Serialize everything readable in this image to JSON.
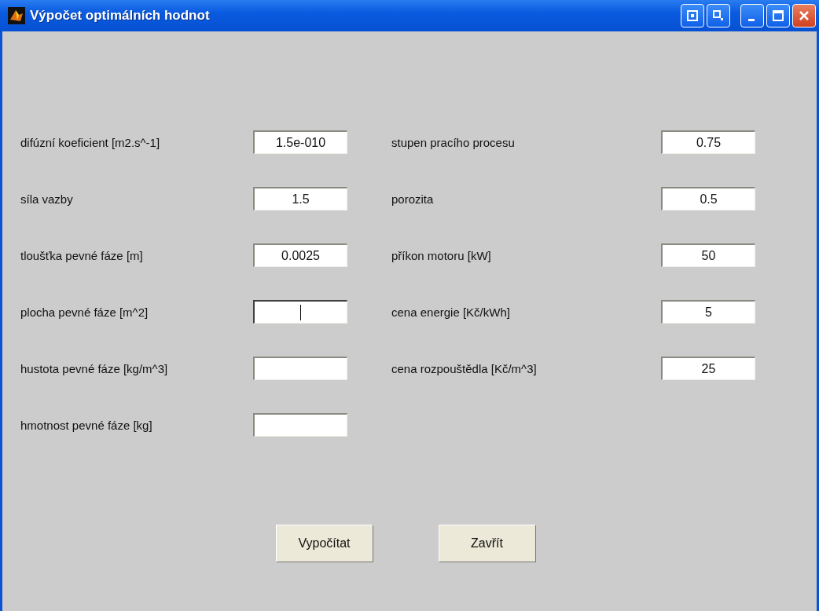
{
  "window": {
    "title": "Výpočet optimálních hodnot"
  },
  "left_fields": [
    {
      "label": "difúzní koeficient [m2.s^-1]",
      "value": "1.5e-010",
      "focused": false
    },
    {
      "label": "síla vazby",
      "value": "1.5",
      "focused": false
    },
    {
      "label": "tloušťka pevné fáze [m]",
      "value": "0.0025",
      "focused": false
    },
    {
      "label": "plocha pevné fáze [m^2]",
      "focused": true
    },
    {
      "label": "hustota pevné fáze [kg/m^3]",
      "focused": false
    },
    {
      "label": "hmotnost pevné fáze [kg]",
      "focused": false
    }
  ],
  "right_fields": [
    {
      "label": "stupen pracího procesu",
      "value": "0.75",
      "focused": false
    },
    {
      "label": "porozita",
      "value": "0.5",
      "focused": false
    },
    {
      "label": "příkon motoru [kW]",
      "value": "50",
      "focused": false
    },
    {
      "label": "cena energie [Kč/kWh]",
      "value": "5",
      "focused": false
    },
    {
      "label": "cena rozpouštědla [Kč/m^3]",
      "value": "25",
      "focused": false
    }
  ],
  "buttons": [
    "Vypočítat",
    "Zavřít"
  ]
}
